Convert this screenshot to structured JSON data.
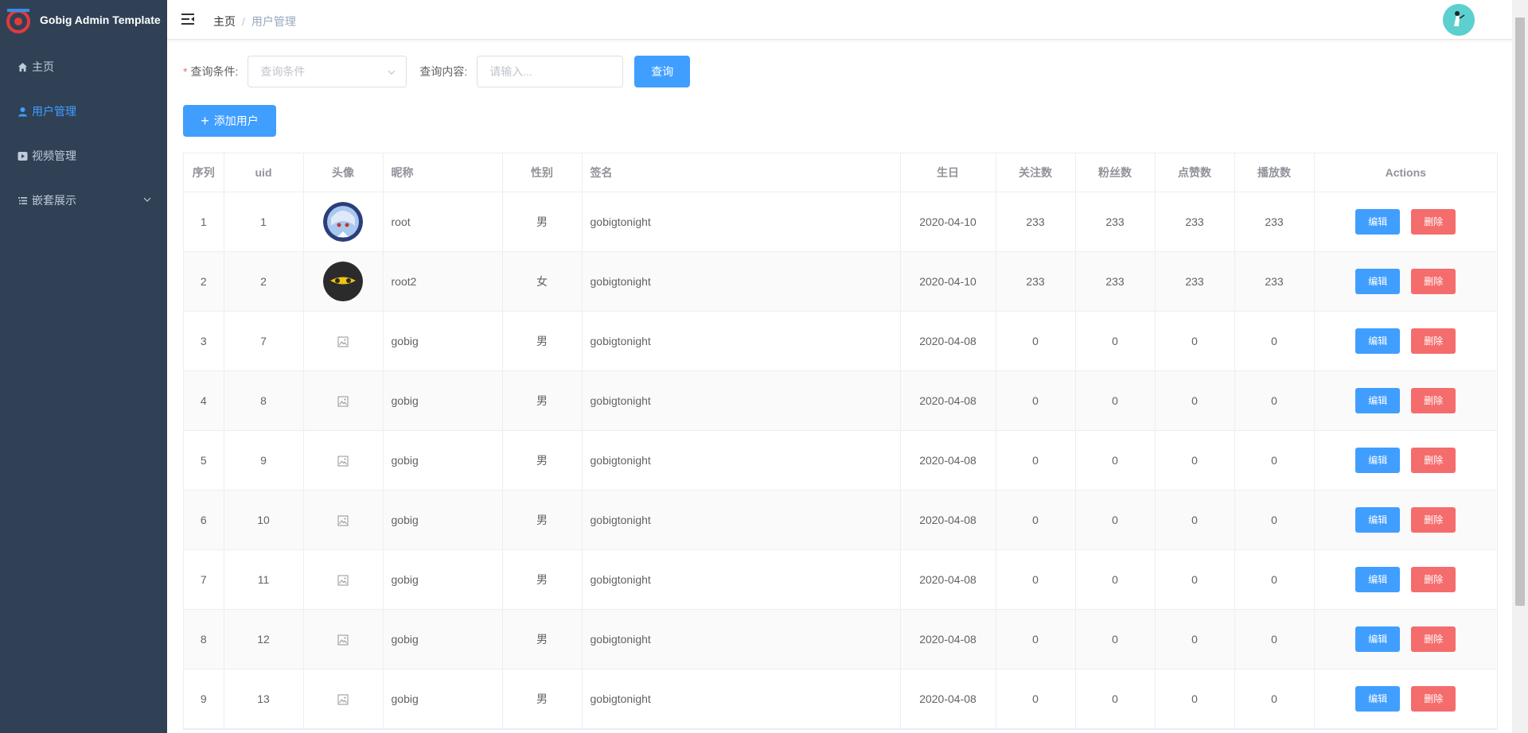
{
  "app": {
    "title": "Gobig Admin Template"
  },
  "sidebar": {
    "items": [
      {
        "label": "主页",
        "icon": "home-icon"
      },
      {
        "label": "用户管理",
        "icon": "user-icon"
      },
      {
        "label": "视频管理",
        "icon": "video-icon"
      },
      {
        "label": "嵌套展示",
        "icon": "list-icon"
      }
    ],
    "active_index": 1,
    "active_color": "#409eff"
  },
  "header": {
    "breadcrumb": {
      "home": "主页",
      "separator": "/",
      "current": "用户管理"
    }
  },
  "filter": {
    "condition_label": "查询条件:",
    "condition_placeholder": "查询条件",
    "content_label": "查询内容:",
    "content_placeholder": "请输入...",
    "query_button": "查询",
    "add_button": "添加用户"
  },
  "table": {
    "columns": [
      "序列",
      "uid",
      "头像",
      "昵称",
      "性别",
      "签名",
      "生日",
      "关注数",
      "粉丝数",
      "点赞数",
      "播放数",
      "Actions"
    ],
    "edit_label": "编辑",
    "delete_label": "删除",
    "rows": [
      {
        "seq": "1",
        "uid": "1",
        "avatar": "anime-avatar",
        "nickname": "root",
        "gender": "男",
        "signature": "gobigtonight",
        "birthday": "2020-04-10",
        "follows": "233",
        "fans": "233",
        "likes": "233",
        "plays": "233"
      },
      {
        "seq": "2",
        "uid": "2",
        "avatar": "ninja-avatar",
        "nickname": "root2",
        "gender": "女",
        "signature": "gobigtonight",
        "birthday": "2020-04-10",
        "follows": "233",
        "fans": "233",
        "likes": "233",
        "plays": "233"
      },
      {
        "seq": "3",
        "uid": "7",
        "avatar": "image-placeholder-icon",
        "nickname": "gobig",
        "gender": "男",
        "signature": "gobigtonight",
        "birthday": "2020-04-08",
        "follows": "0",
        "fans": "0",
        "likes": "0",
        "plays": "0"
      },
      {
        "seq": "4",
        "uid": "8",
        "avatar": "image-placeholder-icon",
        "nickname": "gobig",
        "gender": "男",
        "signature": "gobigtonight",
        "birthday": "2020-04-08",
        "follows": "0",
        "fans": "0",
        "likes": "0",
        "plays": "0"
      },
      {
        "seq": "5",
        "uid": "9",
        "avatar": "image-placeholder-icon",
        "nickname": "gobig",
        "gender": "男",
        "signature": "gobigtonight",
        "birthday": "2020-04-08",
        "follows": "0",
        "fans": "0",
        "likes": "0",
        "plays": "0"
      },
      {
        "seq": "6",
        "uid": "10",
        "avatar": "image-placeholder-icon",
        "nickname": "gobig",
        "gender": "男",
        "signature": "gobigtonight",
        "birthday": "2020-04-08",
        "follows": "0",
        "fans": "0",
        "likes": "0",
        "plays": "0"
      },
      {
        "seq": "7",
        "uid": "11",
        "avatar": "image-placeholder-icon",
        "nickname": "gobig",
        "gender": "男",
        "signature": "gobigtonight",
        "birthday": "2020-04-08",
        "follows": "0",
        "fans": "0",
        "likes": "0",
        "plays": "0"
      },
      {
        "seq": "8",
        "uid": "12",
        "avatar": "image-placeholder-icon",
        "nickname": "gobig",
        "gender": "男",
        "signature": "gobigtonight",
        "birthday": "2020-04-08",
        "follows": "0",
        "fans": "0",
        "likes": "0",
        "plays": "0"
      },
      {
        "seq": "9",
        "uid": "13",
        "avatar": "image-placeholder-icon",
        "nickname": "gobig",
        "gender": "男",
        "signature": "gobigtonight",
        "birthday": "2020-04-08",
        "follows": "0",
        "fans": "0",
        "likes": "0",
        "plays": "0"
      }
    ]
  },
  "colors": {
    "sidebar_bg": "#304156",
    "primary": "#409eff",
    "danger": "#f56c6c"
  }
}
